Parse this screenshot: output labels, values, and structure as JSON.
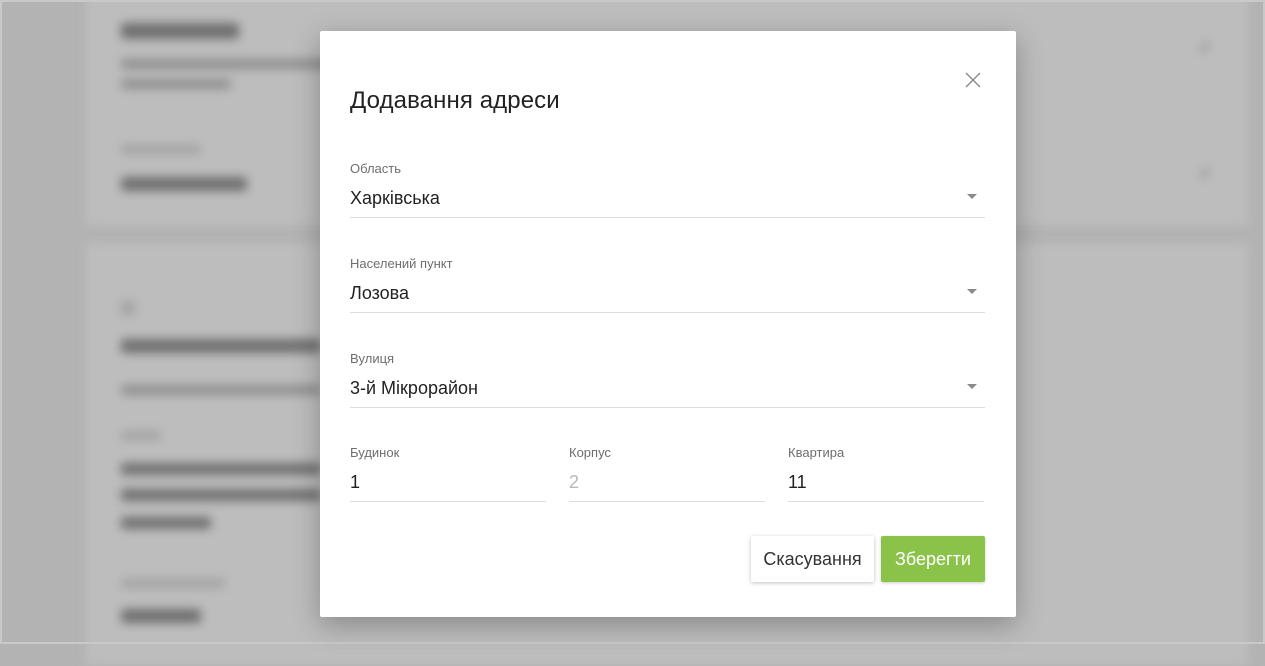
{
  "modal": {
    "title": "Додавання адреси",
    "close_icon": "close-icon"
  },
  "fields": {
    "region": {
      "label": "Область",
      "value": "Харківська"
    },
    "locality": {
      "label": "Населений пункт",
      "value": "Лозова"
    },
    "street": {
      "label": "Вулиця",
      "value": "3-й Мікрорайон"
    },
    "house": {
      "label": "Будинок",
      "value": "1"
    },
    "building": {
      "label": "Корпус",
      "placeholder": "2"
    },
    "apartment": {
      "label": "Квартира",
      "value": "11"
    }
  },
  "buttons": {
    "cancel": "Скасування",
    "save": "Зберегти"
  },
  "colors": {
    "overlay": "#b3b3b3",
    "accent": "#8bc34a",
    "text": "#222222",
    "label": "#6e6e6e"
  }
}
